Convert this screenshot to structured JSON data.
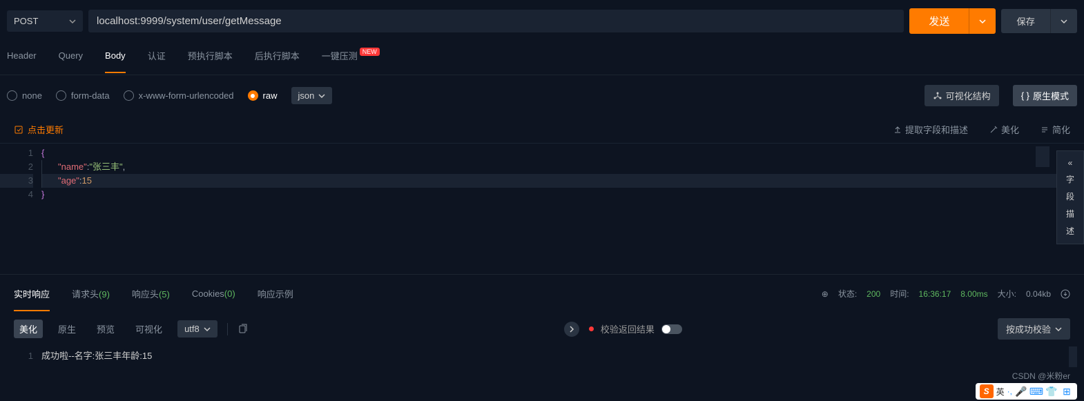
{
  "request": {
    "method": "POST",
    "url": "localhost:9999/system/user/getMessage",
    "send_label": "发送",
    "save_label": "保存"
  },
  "reqTabs": {
    "header": "Header",
    "query": "Query",
    "body": "Body",
    "auth": "认证",
    "pre_script": "预执行脚本",
    "post_script": "后执行脚本",
    "stress": "一键压测",
    "new_badge": "NEW"
  },
  "bodyType": {
    "none": "none",
    "form_data": "form-data",
    "urlencoded": "x-www-form-urlencoded",
    "raw": "raw",
    "json": "json",
    "visual_struct": "可视化结构",
    "native_mode": "原生模式"
  },
  "editorToolbar": {
    "refresh": "点击更新",
    "extract": "提取字段和描述",
    "beautify": "美化",
    "simplify": "简化"
  },
  "editor": {
    "lines": [
      "1",
      "2",
      "3",
      "4"
    ],
    "l1_open": "{",
    "l2_key": "\"name\"",
    "l2_colon": ":",
    "l2_val": "\"张三丰\"",
    "l2_comma": ",",
    "l3_key": "\"age\"",
    "l3_colon": ":",
    "l3_val": "15",
    "l4_close": "}"
  },
  "sidePanel": {
    "collapse": "«",
    "c1": "字",
    "c2": "段",
    "c3": "描",
    "c4": "述"
  },
  "respTabs": {
    "realtime": "实时响应",
    "req_headers": "请求头",
    "req_count": "(9)",
    "resp_headers": "响应头",
    "resp_count": "(5)",
    "cookies": "Cookies",
    "cookies_count": "(0)",
    "example": "响应示例"
  },
  "respStatus": {
    "status_label": "状态:",
    "status_code": "200",
    "time_label": "时间:",
    "time_clock": "16:36:17",
    "duration": "8.00ms",
    "size_label": "大小:",
    "size_val": "0.04kb"
  },
  "respToolbar": {
    "beautify": "美化",
    "raw": "原生",
    "preview": "预览",
    "visual": "可视化",
    "encoding": "utf8",
    "validate_label": "校验返回结果",
    "success_btn": "按成功校验"
  },
  "respBody": {
    "line_no": "1",
    "content": "成功啦--名字:张三丰年龄:15"
  },
  "watermark": "CSDN @米粉er",
  "ime": {
    "lang": "英",
    "punct": "·,"
  }
}
